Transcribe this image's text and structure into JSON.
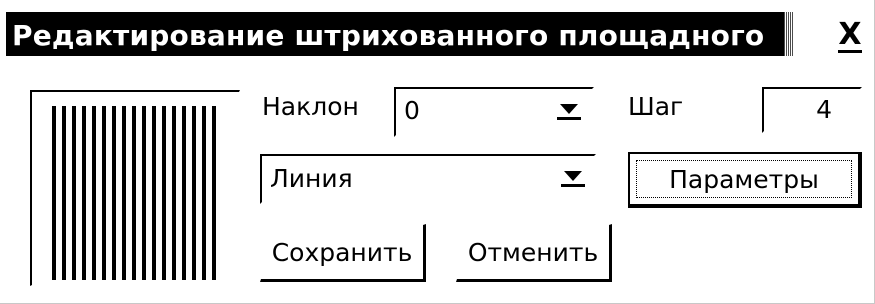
{
  "window": {
    "title": "Редактирование штрихованного площадного",
    "close_label": "X"
  },
  "preview": {
    "pattern": "vertical-lines"
  },
  "angle": {
    "label": "Наклон",
    "value": "0"
  },
  "step": {
    "label": "Шаг",
    "value": "4"
  },
  "type": {
    "value": "Линия"
  },
  "buttons": {
    "params": "Параметры",
    "save": "Сохранить",
    "cancel": "Отменить"
  },
  "icons": {
    "close": "close-icon",
    "dropdown": "chevron-down-icon"
  },
  "colors": {
    "title_bg": "#000000",
    "title_fg": "#ffffff",
    "background": "#ffffff"
  }
}
